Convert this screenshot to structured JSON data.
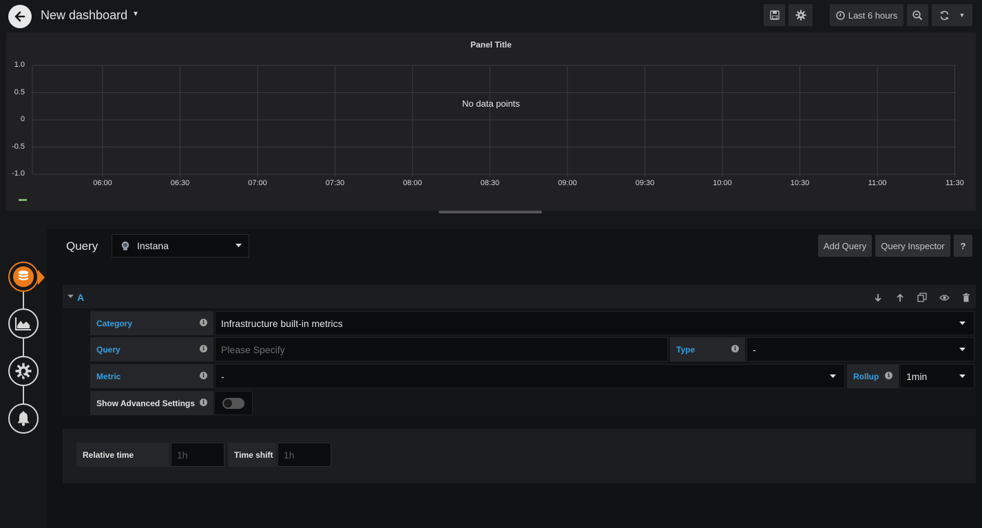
{
  "navbar": {
    "title": "New dashboard",
    "time_range": "Last 6 hours"
  },
  "panel": {
    "title": "Panel Title",
    "no_data": "No data points",
    "y_ticks": [
      "1.0",
      "0.5",
      "0",
      "-0.5",
      "-1.0"
    ],
    "x_ticks": [
      "06:00",
      "06:30",
      "07:00",
      "07:30",
      "08:00",
      "08:30",
      "09:00",
      "09:30",
      "10:00",
      "10:30",
      "11:00",
      "11:30"
    ]
  },
  "query_editor": {
    "label": "Query",
    "datasource": "Instana",
    "add_query": "Add Query",
    "query_inspector": "Query Inspector",
    "help": "?",
    "ref_id": "A",
    "fields": {
      "category_label": "Category",
      "category_value": "Infrastructure built-in metrics",
      "query_label": "Query",
      "query_placeholder": "Please Specify",
      "type_label": "Type",
      "type_value": "-",
      "metric_label": "Metric",
      "metric_value": "-",
      "rollup_label": "Rollup",
      "rollup_value": "1min",
      "advanced_label": "Show Advanced Settings"
    },
    "options": {
      "relative_time_label": "Relative time",
      "relative_time_placeholder": "1h",
      "time_shift_label": "Time shift",
      "time_shift_placeholder": "1h"
    }
  },
  "colors": {
    "accent": "#eb7b18",
    "link_blue": "#33a2e5",
    "legend_green": "#7eb26d"
  }
}
